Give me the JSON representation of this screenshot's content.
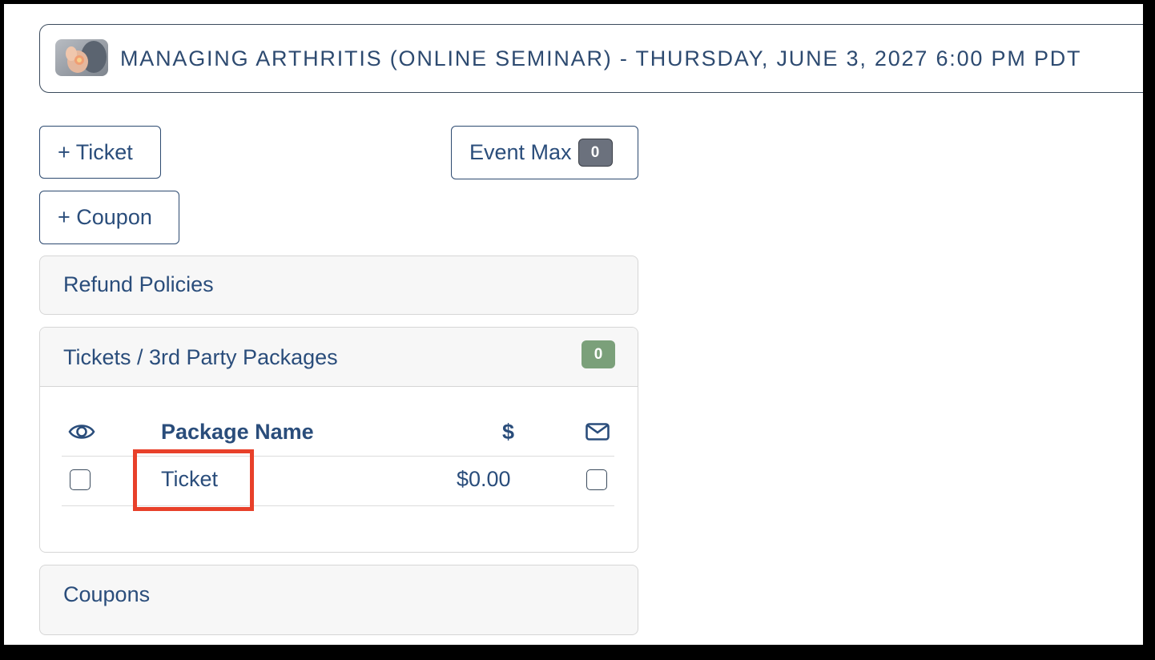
{
  "event": {
    "title": "MANAGING ARTHRITIS (ONLINE SEMINAR) - THURSDAY, JUNE 3, 2027 6:00 PM PDT"
  },
  "actions": {
    "add_ticket": "+ Ticket",
    "add_coupon": "+ Coupon",
    "event_max_label": "Event Max",
    "event_max_count": "0"
  },
  "panels": {
    "refund_policies": "Refund Policies",
    "tickets": {
      "title": "Tickets / 3rd Party Packages",
      "count": "0",
      "columns": {
        "visibility_icon": "eye-icon",
        "package_name": "Package Name",
        "price": "$",
        "email_icon": "envelope-icon"
      },
      "rows": [
        {
          "name": "Ticket",
          "price": "$0.00",
          "visible": false,
          "email": false
        }
      ]
    },
    "coupons": "Coupons"
  },
  "colors": {
    "text": "#2a4d7b",
    "badge_gray": "#6b717d",
    "badge_green": "#7ba07a",
    "highlight": "#e8402a"
  }
}
